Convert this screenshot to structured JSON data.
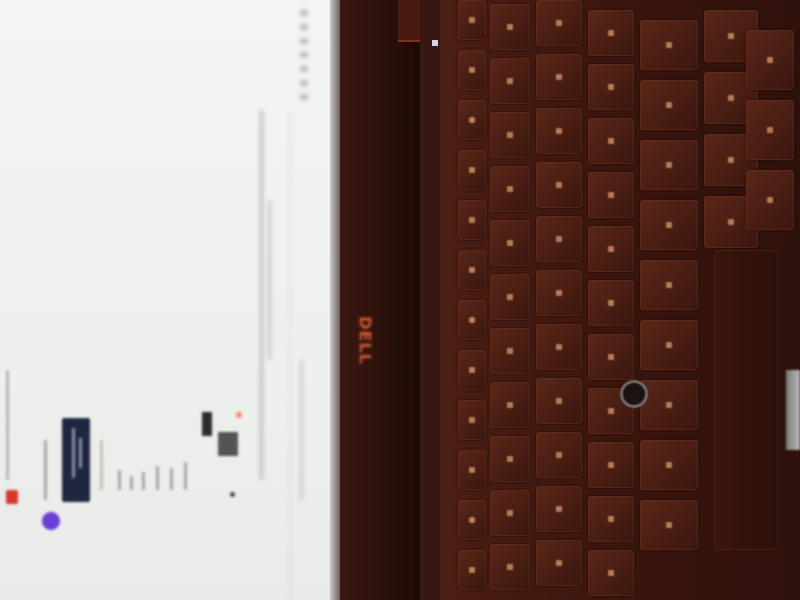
{
  "photo": {
    "subject": "laptop-screen-and-keyboard",
    "brand_logo": "DELL",
    "colors": {
      "screen_bg": "#f0f1ef",
      "chassis": "#3a150e",
      "logo": "#d25a34",
      "accent_purple": "#6a3fd6",
      "accent_red": "#d9372b",
      "card_dark": "#1f2640"
    },
    "icons": [
      "trackpoint-icon",
      "brand-logo"
    ]
  }
}
